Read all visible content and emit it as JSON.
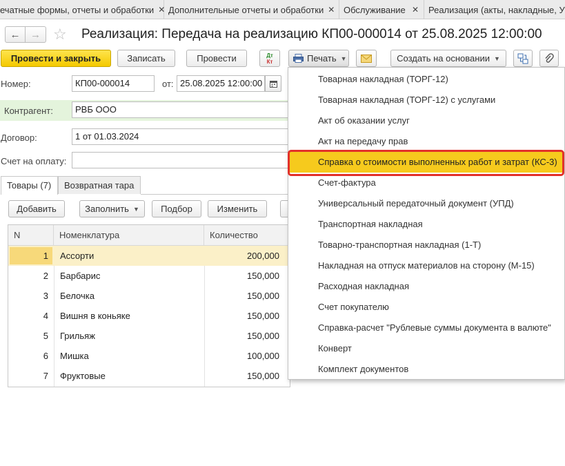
{
  "tabs": [
    {
      "label": "ечатные формы, отчеты и обработки",
      "closable": true
    },
    {
      "label": "Дополнительные отчеты и обработки",
      "closable": true
    },
    {
      "label": "Обслуживание",
      "closable": true
    },
    {
      "label": "Реализация (акты, накладные, У",
      "closable": false
    }
  ],
  "tab_close_glyph": "✕",
  "header": {
    "title": "Реализация: Передача на реализацию КП00-000014 от 25.08.2025 12:00:00",
    "back_glyph": "←",
    "forward_glyph": "→",
    "star_glyph": "☆"
  },
  "toolbar": {
    "post_close": "Провести и закрыть",
    "save": "Записать",
    "post": "Провести",
    "dt_label": "Дт",
    "kt_label": "Кт",
    "print": "Печать",
    "create_based": "Создать на основании"
  },
  "form": {
    "number_label": "Номер:",
    "number_value": "КП00-000014",
    "date_label": "от:",
    "date_value": "25.08.2025 12:00:00",
    "counterparty_label": "Контрагент:",
    "counterparty_value": "РВБ ООО",
    "contract_label": "Договор:",
    "contract_value": "1 от 01.03.2024",
    "invoice_label": "Счет на оплату:",
    "invoice_value": ""
  },
  "form_tabs": [
    {
      "label": "Товары (7)",
      "active": true
    },
    {
      "label": "Возвратная тара",
      "active": false
    }
  ],
  "table_toolbar": {
    "add": "Добавить",
    "fill": "Заполнить",
    "selection": "Подбор",
    "change": "Изменить"
  },
  "table": {
    "columns": [
      "N",
      "Номенклатура",
      "Количество"
    ],
    "rows": [
      {
        "n": "1",
        "name": "Ассорти",
        "qty": "200,000",
        "selected": true
      },
      {
        "n": "2",
        "name": "Барбарис",
        "qty": "150,000"
      },
      {
        "n": "3",
        "name": "Белочка",
        "qty": "150,000"
      },
      {
        "n": "4",
        "name": "Вишня в коньяке",
        "qty": "150,000"
      },
      {
        "n": "5",
        "name": "Грильяж",
        "qty": "150,000"
      },
      {
        "n": "6",
        "name": "Мишка",
        "qty": "100,000"
      },
      {
        "n": "7",
        "name": "Фруктовые",
        "qty": "150,000"
      }
    ]
  },
  "print_menu": {
    "items": [
      "Товарная накладная (ТОРГ-12)",
      "Товарная накладная (ТОРГ-12) с услугами",
      "Акт об оказании услуг",
      "Акт на передачу прав",
      "Справка о стоимости выполненных работ и затрат (КС-3)",
      "Счет-фактура",
      "Универсальный передаточный документ (УПД)",
      "Транспортная накладная",
      "Товарно-транспортная накладная (1-Т)",
      "Накладная на отпуск материалов на сторону (М-15)",
      "Расходная накладная",
      "Счет покупателю",
      "Справка-расчет \"Рублевые суммы документа в валюте\"",
      "Конверт",
      "Комплект документов"
    ],
    "highlighted_index": 4
  },
  "colors": {
    "primary_button": "#f4c900",
    "highlight": "#f6ca1d",
    "highlight_outline": "#e2312a",
    "counterparty_bg": "#e4f4dc",
    "selected_row": "#fbf0c8"
  }
}
